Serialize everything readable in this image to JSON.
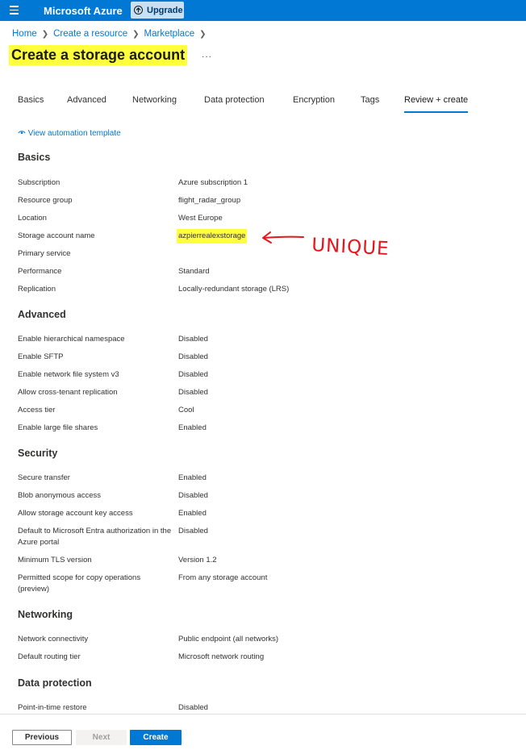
{
  "topbar": {
    "brand": "Microsoft Azure",
    "upgrade_label": "Upgrade"
  },
  "breadcrumb": [
    "Home",
    "Create a resource",
    "Marketplace"
  ],
  "page_title": "Create a storage account",
  "more_label": "...",
  "tabs": [
    "Basics",
    "Advanced",
    "Networking",
    "Data protection",
    "Encryption",
    "Tags",
    "Review + create"
  ],
  "active_tab": "Review + create",
  "automation_link": "View automation template",
  "sections": {
    "basics": {
      "title": "Basics",
      "rows": [
        {
          "label": "Subscription",
          "value": "Azure subscription 1"
        },
        {
          "label": "Resource group",
          "value": "flight_radar_group"
        },
        {
          "label": "Location",
          "value": "West Europe"
        },
        {
          "label": "Storage account name",
          "value": "azpierrealexstorage"
        },
        {
          "label": "Primary service",
          "value": ""
        },
        {
          "label": "Performance",
          "value": "Standard"
        },
        {
          "label": "Replication",
          "value": "Locally-redundant storage (LRS)"
        }
      ]
    },
    "advanced": {
      "title": "Advanced",
      "rows": [
        {
          "label": "Enable hierarchical namespace",
          "value": "Disabled"
        },
        {
          "label": "Enable SFTP",
          "value": "Disabled"
        },
        {
          "label": "Enable network file system v3",
          "value": "Disabled"
        },
        {
          "label": "Allow cross-tenant replication",
          "value": "Disabled"
        },
        {
          "label": "Access tier",
          "value": "Cool"
        },
        {
          "label": "Enable large file shares",
          "value": "Enabled"
        }
      ]
    },
    "security": {
      "title": "Security",
      "rows": [
        {
          "label": "Secure transfer",
          "value": "Enabled"
        },
        {
          "label": "Blob anonymous access",
          "value": "Disabled"
        },
        {
          "label": "Allow storage account key access",
          "value": "Enabled"
        },
        {
          "label": "Default to Microsoft Entra authorization in the Azure portal",
          "value": "Disabled"
        },
        {
          "label": "Minimum TLS version",
          "value": "Version 1.2"
        },
        {
          "label": "Permitted scope for copy operations (preview)",
          "value": "From any storage account"
        }
      ]
    },
    "networking": {
      "title": "Networking",
      "rows": [
        {
          "label": "Network connectivity",
          "value": "Public endpoint (all networks)"
        },
        {
          "label": "Default routing tier",
          "value": "Microsoft network routing"
        }
      ]
    },
    "data_protection": {
      "title": "Data protection",
      "rows": [
        {
          "label": "Point-in-time restore",
          "value": "Disabled"
        }
      ]
    }
  },
  "annotation_text": "UNIQUE",
  "footer": {
    "previous": "Previous",
    "next": "Next",
    "create": "Create"
  },
  "colors": {
    "azure_blue": "#0078d4",
    "highlight": "#ffff3c",
    "annotation_red": "#e8141c"
  }
}
